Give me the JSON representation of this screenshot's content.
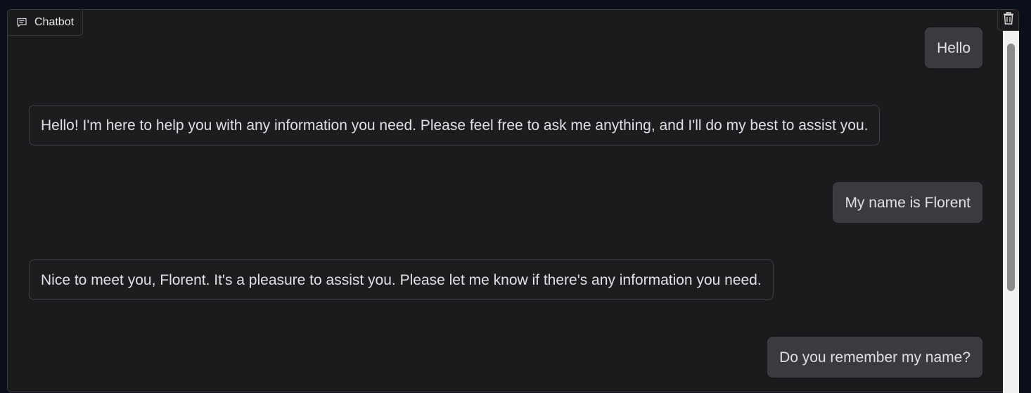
{
  "chatbot": {
    "label": "Chatbot",
    "label_icon": "chat-icon",
    "clear_icon": "trash-icon"
  },
  "messages": [
    {
      "role": "user",
      "text": "Hello"
    },
    {
      "role": "bot",
      "text": "Hello! I'm here to help you with any information you need. Please feel free to ask me anything, and I'll do my best to assist you."
    },
    {
      "role": "user",
      "text": "My name is Florent"
    },
    {
      "role": "bot",
      "text": "Nice to meet you, Florent. It's a pleasure to assist you. Please let me know if there's any information you need."
    },
    {
      "role": "user",
      "text": "Do you remember my name?"
    }
  ],
  "colors": {
    "panel_bg": "#1b1b1d",
    "user_bubble": "#3a3b40",
    "bot_bubble": "#1d1d20",
    "text": "#dfe0e3"
  }
}
